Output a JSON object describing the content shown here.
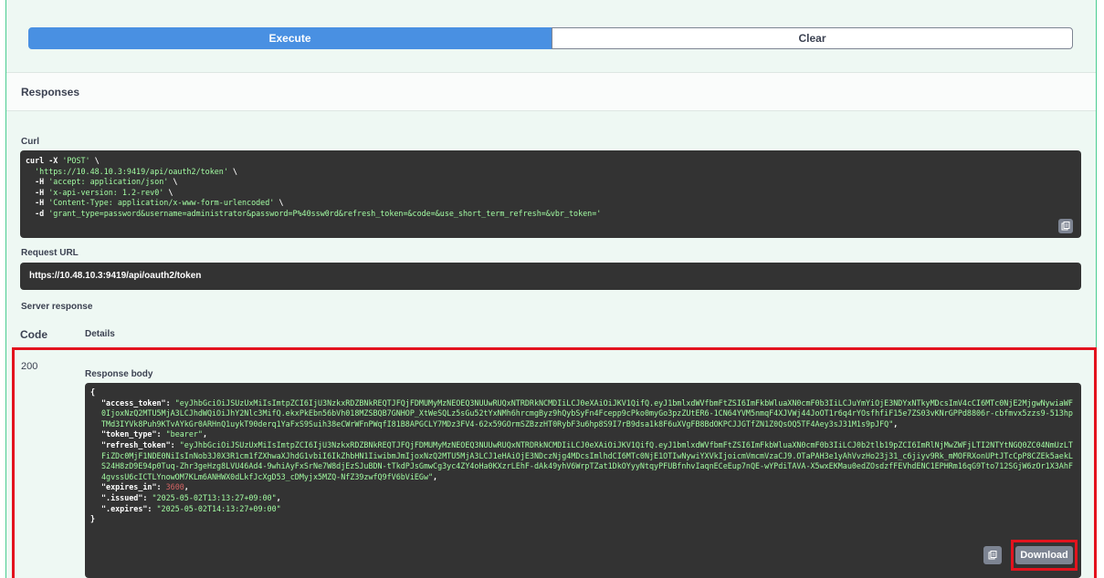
{
  "execute": {
    "execute_label": "Execute",
    "clear_label": "Clear"
  },
  "responses": {
    "title": "Responses"
  },
  "curl": {
    "label": "Curl",
    "lines": [
      [
        "curl -X ",
        "'POST'",
        " \\"
      ],
      [
        "  ",
        "'https://10.48.10.3:9419/api/oauth2/token'",
        " \\"
      ],
      [
        "  -H ",
        "'accept: application/json'",
        " \\"
      ],
      [
        "  -H ",
        "'x-api-version: 1.2-rev0'",
        " \\"
      ],
      [
        "  -H ",
        "'Content-Type: application/x-www-form-urlencoded'",
        " \\"
      ],
      [
        "  -d ",
        "'grant_type=password&username=administrator&password=P%40ssw0rd&refresh_token=&code=&use_short_term_refresh=&vbr_token='",
        ""
      ]
    ]
  },
  "request_url": {
    "label": "Request URL",
    "value": "https://10.48.10.3:9419/api/oauth2/token"
  },
  "server_response": {
    "label": "Server response",
    "code_header": "Code",
    "details_header": "Details",
    "status_code": "200",
    "body_label": "Response body",
    "open_brace": "{",
    "close_brace": "}",
    "fields": [
      {
        "key": "\"access_token\"",
        "value": "\"eyJhbGciOiJSUzUxMiIsImtpZCI6IjU3NzkxRDZBNkREQTJFQjFDMUMyMzNEOEQ3NUUwRUQxNTRDRkNCMDIiLCJ0eXAiOiJKV1QifQ.eyJ1bmlxdWVfbmFtZSI6ImFkbWluaXN0cmF0b3IiLCJuYmYiOjE3NDYxNTkyMDcsImV4cCI6MTc0NjE2MjgwNywiaWF0IjoxNzQ2MTU5MjA3LCJhdWQiOiJhY2Nlc3MifQ.ekxPkEbn56bVh018MZSBQB7GNHOP_XtWeSQLz5sGu52tYxNMh6hrcmgByz9hQybSyFn4Fcepp9cPko0myGo3pzZUtER6-1CN64YVM5nmqF4XJVWj44JoOT1r6q4rYOsfhfiF15e7ZS03vKNrGPPd8806r-cbfmvx5zzs9-513hpTMd3IYVk8Puh9KTvAYkGr0ARHnQ1uykT90derq1YaFxS9Suih38eCWrWFnPWqfI81B8APGCLY7MDz3FV4-62x59GOrmSZBzzHT0RybF3u6hp8S9I7rB9dsa1k8F6uXVgFB8BdOKPCJJGTfZN1Z0QsOQ5TF4Aey3sJ31M1s9pJFQ\"",
        "type": "str"
      },
      {
        "key": "\"token_type\"",
        "value": "\"bearer\"",
        "type": "str"
      },
      {
        "key": "\"refresh_token\"",
        "value": "\"eyJhbGciOiJSUzUxMiIsImtpZCI6IjU3NzkxRDZBNkREQTJFQjFDMUMyMzNEOEQ3NUUwRUQxNTRDRkNCMDIiLCJ0eXAiOiJKV1QifQ.eyJ1bmlxdWVfbmFtZSI6ImFkbWluaXN0cmF0b3IiLCJ0b2tlb19pZCI6ImRlNjMwZWFjLTI2NTYtNGQ0ZC04NmUzLTFiZDc0MjF1NDE0NiIsInNob3J0X3R1cm1fZXhwaXJhdG1vbiI6IkZhbHN1IiwibmJmIjoxNzQ2MTU5MjA3LCJ1eHAiOjE3NDczNjg4MDcsImlhdCI6MTc0NjE1OTIwNywiYXVkIjoicmVmcmVzaCJ9.OTaPAH3e1yAhVvzHo23j31_c6jiyv9Rk_mMOFRXonUPtJTcCpP8CZEk5aekLS24H8zD9E94p0Tuq-Zhr3geHzg8LVU46Ad4-9whiAyFxSrNe7W8djEzSJuBDN-tTkdPJsGmwCg3yc4ZY4oHa0KXzrLEhF-dAk49yhV6WrpTZat1DkOYyyNtqyPFUBfnhvIaqnECeEup7nQE-wYPdiTAVA-X5wxEKMau0edZOsdzfFEVhdENC1EPHRm16qG9Tto712SGjW6zOr1X3AhF4gvssU6cICTLYnowOM7KLm6ANHWX0dLkfJcXgD53_cDMyjx5MZQ-NfZ39zwfQ9fV6bViEGw\"",
        "type": "str"
      },
      {
        "key": "\"expires_in\"",
        "value": "3600",
        "type": "num"
      },
      {
        "key": "\".issued\"",
        "value": "\"2025-05-02T13:13:27+09:00\"",
        "type": "str"
      },
      {
        "key": "\".expires\"",
        "value": "\"2025-05-02T14:13:27+09:00\"",
        "type": "str"
      }
    ],
    "download_label": "Download"
  },
  "icons": {
    "copy": "copy-to-clipboard-icon"
  },
  "colors": {
    "execute": "#4990e2",
    "string": "#a2fca2",
    "number": "#d36363",
    "highlight": "#e3131e",
    "code_bg": "#333333"
  }
}
